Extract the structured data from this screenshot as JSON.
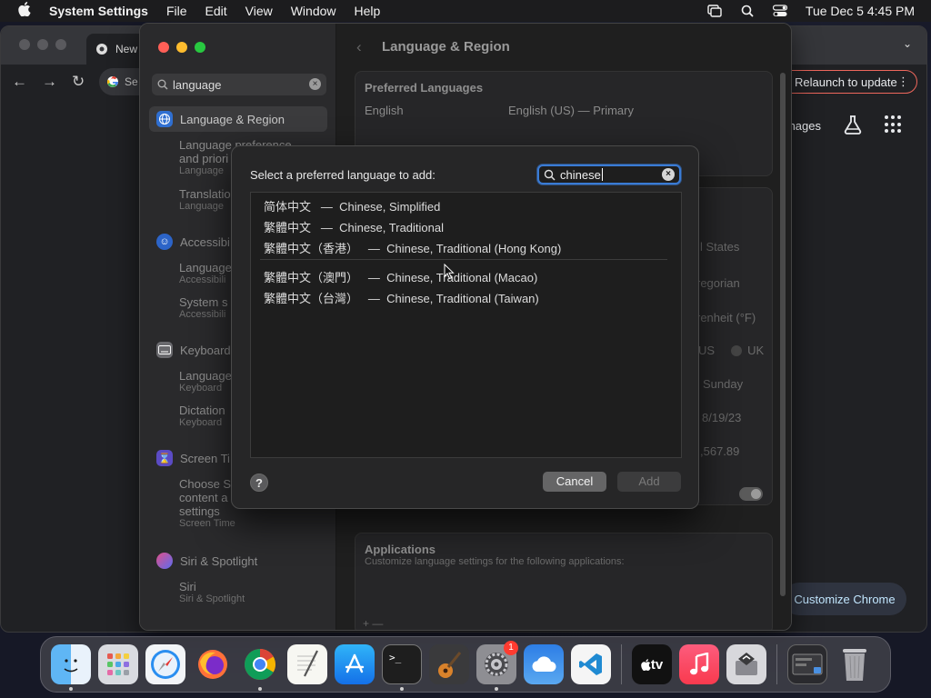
{
  "menubar": {
    "app_name": "System Settings",
    "menus": [
      "File",
      "Edit",
      "View",
      "Window",
      "Help"
    ],
    "datetime": "Tue Dec 5  4:45 PM"
  },
  "chrome": {
    "tab_title": "New",
    "omnibox_text": "Se",
    "relaunch_label": "Relaunch to update",
    "shortcut_label": "nages",
    "customize_label": "Customize Chrome"
  },
  "settings": {
    "search_value": "language",
    "title": "Language & Region",
    "sidebar": {
      "language_region": "Language & Region",
      "lang_pref_line1": "Language preference",
      "lang_pref_line2": "and priori",
      "lang_pref_small": "Language",
      "translation": "Translatio",
      "translation_small": "Language",
      "accessibility": "Accessibi",
      "acc_lang": "Language",
      "acc_lang_small": "Accessibili",
      "acc_sys": "System s",
      "acc_sys_small": "Accessibili",
      "keyboard": "Keyboard",
      "kb_lang": "Language",
      "kb_lang_small": "Keyboard",
      "kb_dict": "Dictation",
      "kb_dict_small": "Keyboard",
      "screen_time": "Screen Ti",
      "st_line1": "Choose S",
      "st_line2": "content a",
      "st_line3": "settings",
      "st_small": "Screen Time",
      "siri": "Siri & Spotlight",
      "siri_sub": "Siri",
      "siri_small": "Siri & Spotlight"
    },
    "content": {
      "preferred_heading": "Preferred Languages",
      "english_label": "English",
      "english_detail": "English (US) — Primary",
      "region_value": "l States",
      "calendar_value": "regorian",
      "temperature_value": "renheit (°F)",
      "measure_us": "US",
      "measure_uk": "UK",
      "first_day_value": "Sunday",
      "date_format_value": "8/19/23",
      "number_format_value": ",567.89",
      "applications_heading": "Applications",
      "applications_desc": "Customize language settings for the following applications:",
      "add_remove": "+  —"
    }
  },
  "sheet": {
    "prompt": "Select a preferred language to add:",
    "search_value": "chinese",
    "languages": [
      {
        "native": "简体中文",
        "name": "Chinese, Simplified"
      },
      {
        "native": "繁體中文",
        "name": "Chinese, Traditional"
      },
      {
        "native": "繁體中文（香港）",
        "name": "Chinese, Traditional (Hong Kong)"
      },
      {
        "native": "繁體中文（澳門）",
        "name": "Chinese, Traditional (Macao)"
      },
      {
        "native": "繁體中文（台灣）",
        "name": "Chinese, Traditional (Taiwan)"
      }
    ],
    "dash": "—",
    "help_label": "?",
    "cancel_label": "Cancel",
    "add_label": "Add"
  },
  "dock": {
    "system_settings_badge": "1",
    "tv_label": "tv"
  }
}
